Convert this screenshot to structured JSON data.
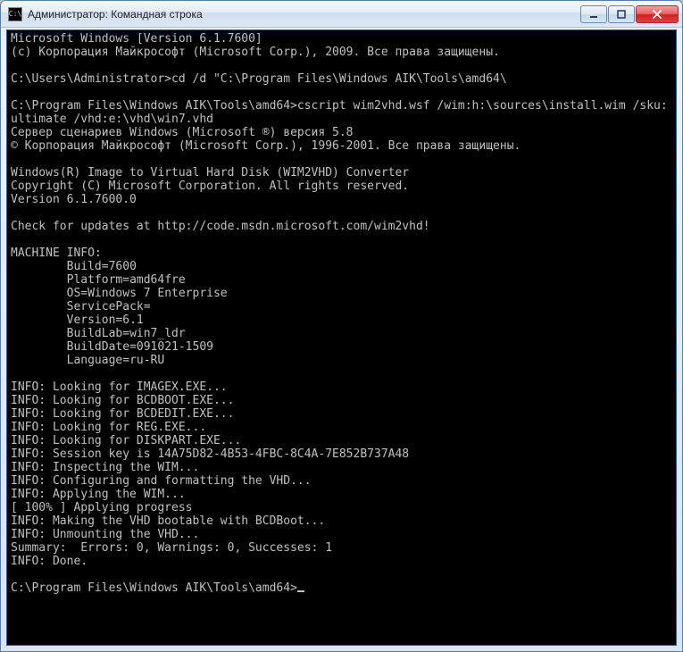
{
  "window": {
    "title": "Администратор: Командная строка",
    "icon_label": "C:\\"
  },
  "console": {
    "lines": [
      "Microsoft Windows [Version 6.1.7600]",
      "(c) Корпорация Майкрософт (Microsoft Corp.), 2009. Все права защищены.",
      "",
      "C:\\Users\\Administrator>cd /d \"C:\\Program Files\\Windows AIK\\Tools\\amd64\\",
      "",
      "C:\\Program Files\\Windows AIK\\Tools\\amd64>cscript wim2vhd.wsf /wim:h:\\sources\\install.wim /sku:ultimate /vhd:e:\\vhd\\win7.vhd",
      "Сервер сценариев Windows (Microsoft ®) версия 5.8",
      "© Корпорация Майкрософт (Microsoft Corp.), 1996-2001. Все права защищены.",
      "",
      "Windows(R) Image to Virtual Hard Disk (WIM2VHD) Converter",
      "Copyright (C) Microsoft Corporation. All rights reserved.",
      "Version 6.1.7600.0",
      "",
      "Check for updates at http://code.msdn.microsoft.com/wim2vhd!",
      "",
      "MACHINE INFO:",
      "        Build=7600",
      "        Platform=amd64fre",
      "        OS=Windows 7 Enterprise",
      "        ServicePack=",
      "        Version=6.1",
      "        BuildLab=win7_ldr",
      "        BuildDate=091021-1509",
      "        Language=ru-RU",
      "",
      "INFO: Looking for IMAGEX.EXE...",
      "INFO: Looking for BCDBOOT.EXE...",
      "INFO: Looking for BCDEDIT.EXE...",
      "INFO: Looking for REG.EXE...",
      "INFO: Looking for DISKPART.EXE...",
      "INFO: Session key is 14A75D82-4B53-4FBC-8C4A-7E852B737A48",
      "INFO: Inspecting the WIM...",
      "INFO: Configuring and formatting the VHD...",
      "INFO: Applying the WIM...",
      "[ 100% ] Applying progress",
      "INFO: Making the VHD bootable with BCDBoot...",
      "INFO: Unmounting the VHD...",
      "Summary:  Errors: 0, Warnings: 0, Successes: 1",
      "INFO: Done.",
      "",
      "C:\\Program Files\\Windows AIK\\Tools\\amd64>"
    ]
  }
}
